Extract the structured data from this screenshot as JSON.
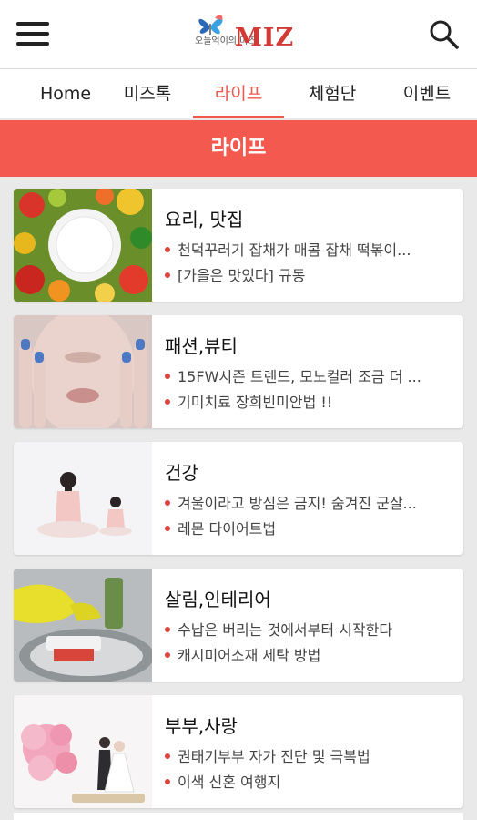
{
  "header": {
    "logo_word": "MIZ",
    "logo_small": "오늘억이의 미즈"
  },
  "tabs": [
    {
      "label": "Home"
    },
    {
      "label": "미즈톡"
    },
    {
      "label": "라이프"
    },
    {
      "label": "체험단"
    },
    {
      "label": "이벤트"
    }
  ],
  "active_tab": "라이프",
  "banner": {
    "title": "라이프"
  },
  "cards": [
    {
      "title": "요리, 맛집",
      "lines": [
        "천덕꾸러기 잡채가 매콤 잡채 떡볶이...",
        "[가을은 맛있다] 규동"
      ],
      "thumb": "vegetables-plate"
    },
    {
      "title": "패션,뷰티",
      "lines": [
        "15FW시즌 트렌드, 모노컬러 조금 더 ...",
        "기미치료 장희빈미안법 !!"
      ],
      "thumb": "face-hands-nails"
    },
    {
      "title": "건강",
      "lines": [
        "겨울이라고 방심은 금지! 숨겨진 군살...",
        "레몬 다이어트법"
      ],
      "thumb": "yoga-meditation"
    },
    {
      "title": "살림,인테리어",
      "lines": [
        "수납은 버리는 것에서부터 시작한다",
        "캐시미어소재 세탁 방법"
      ],
      "thumb": "sink-gloves-dishes"
    },
    {
      "title": "부부,사랑",
      "lines": [
        "권태기부부 자가 진단 및 극복법",
        "이색 신혼 여행지"
      ],
      "thumb": "wedding-flowers"
    }
  ],
  "colors": {
    "accent": "#f3594f",
    "bullet": "#e0433b",
    "background": "#e9e9ea"
  }
}
